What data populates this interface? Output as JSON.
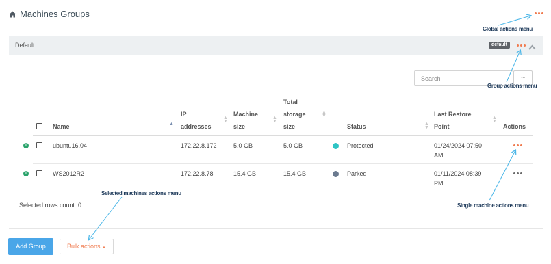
{
  "page": {
    "title": "Machines Groups"
  },
  "group": {
    "name": "Default",
    "badge": "default"
  },
  "search": {
    "placeholder": "Search"
  },
  "table": {
    "headers": {
      "name": "Name",
      "ip_line1": "IP",
      "ip_line2": "addresses",
      "size_line1": "Machine",
      "size_line2": "size",
      "storage_line1": "Total",
      "storage_line2": "storage",
      "storage_line3": "size",
      "status": "Status",
      "restore_line1": "Last Restore",
      "restore_line2": "Point",
      "actions": "Actions"
    },
    "rows": [
      {
        "name": "ubuntu16.04",
        "ip": "172.22.8.172",
        "machine_size": "5.0 GB",
        "total_storage": "5.0 GB",
        "status": "Protected",
        "status_color": "#2ec4c4",
        "restore_line1": "01/24/2024 07:50",
        "restore_line2": "AM",
        "actions_icon": "ellipsis-icon",
        "actions_color": "#f07b4f"
      },
      {
        "name": "WS2012R2",
        "ip": "172.22.8.78",
        "machine_size": "15.4 GB",
        "total_storage": "15.4 GB",
        "status": "Parked",
        "status_color": "#6b7a8f",
        "restore_line1": "01/11/2024 08:39",
        "restore_line2": "PM",
        "actions_icon": "ellipsis-icon",
        "actions_color": "#6a6a6a"
      }
    ]
  },
  "footer": {
    "selected_count": "Selected rows count: 0"
  },
  "buttons": {
    "add_group": "Add Group",
    "bulk_actions": "Bulk actions"
  },
  "callouts": {
    "global": "Global actions menu",
    "group": "Group actions menu",
    "selected": "Selected machines actions menu",
    "single": "Single machine actions menu"
  },
  "colors": {
    "accent": "#f07b4f",
    "primary": "#4aa6e8",
    "callout_arrow": "#49b6e8"
  }
}
